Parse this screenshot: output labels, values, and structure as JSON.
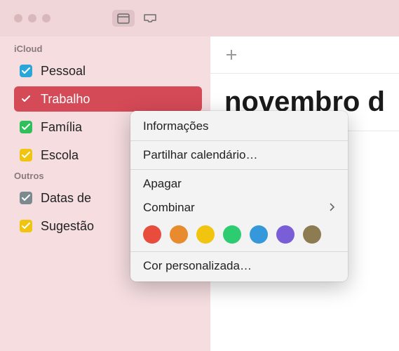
{
  "header": {
    "month": "novembro d"
  },
  "sidebar": {
    "sections": [
      {
        "title": "iCloud",
        "items": [
          {
            "label": "Pessoal",
            "color": "#2aa6d8",
            "selected": false
          },
          {
            "label": "Trabalho",
            "color": "#d54a57",
            "selected": true
          },
          {
            "label": "Família",
            "color": "#30c05b",
            "selected": false
          },
          {
            "label": "Escola",
            "color": "#f1c40f",
            "selected": false
          }
        ]
      },
      {
        "title": "Outros",
        "items": [
          {
            "label": "Datas de",
            "color": "#7a8a8f",
            "selected": false
          },
          {
            "label": "Sugestão",
            "color": "#f1c40f",
            "selected": false
          }
        ]
      }
    ]
  },
  "menu": {
    "info": "Informações",
    "share": "Partilhar calendário…",
    "delete": "Apagar",
    "combine": "Combinar",
    "custom_color": "Cor personalizada…",
    "colors": [
      "#e74c3c",
      "#e88b2e",
      "#f1c40f",
      "#2ecc71",
      "#3498db",
      "#7a5ed8",
      "#8d7b52"
    ]
  }
}
